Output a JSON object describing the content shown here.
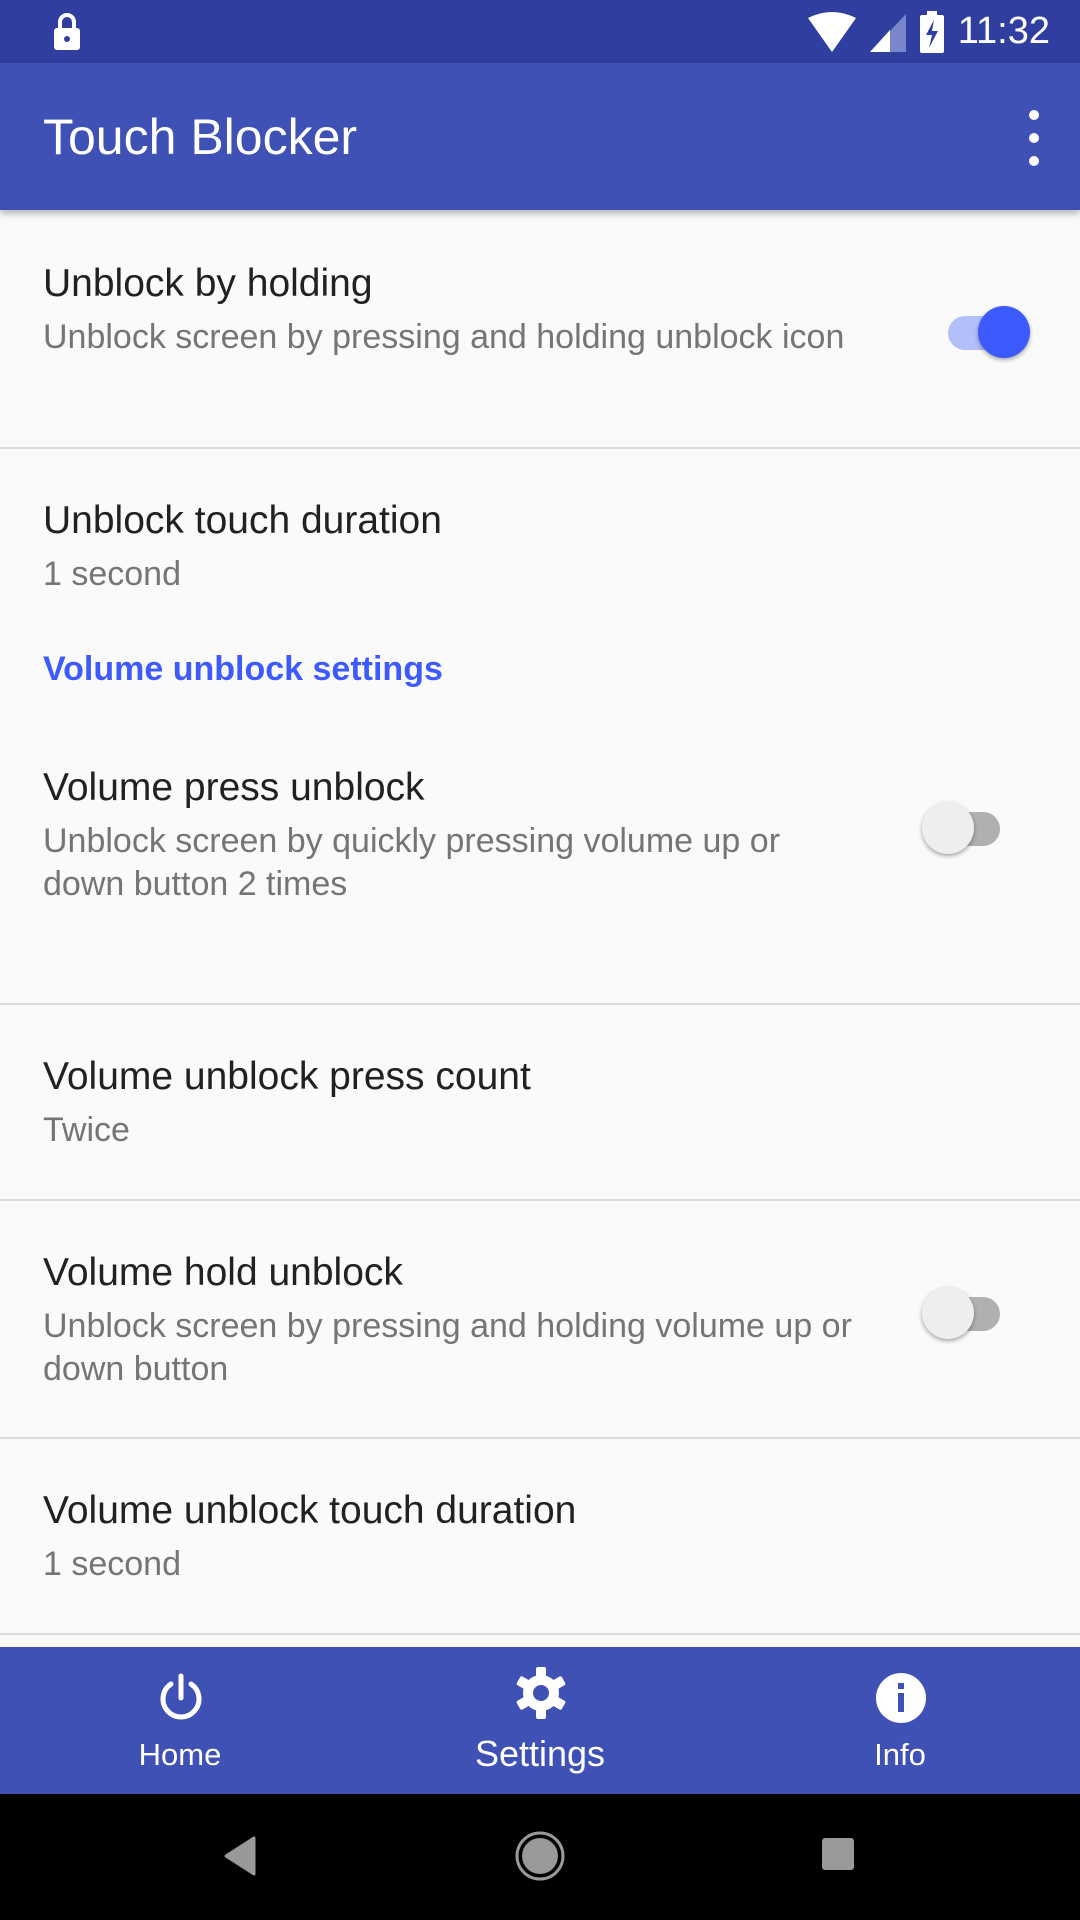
{
  "status_bar": {
    "time": "11:32"
  },
  "app_bar": {
    "title": "Touch Blocker"
  },
  "settings": [
    {
      "title": "Unblock by holding",
      "summary": "Unblock screen by pressing and holding unblock icon",
      "toggle": true
    },
    {
      "title": "Unblock touch duration",
      "summary": "1 second"
    },
    {
      "category": "Volume unblock settings"
    },
    {
      "title": "Volume press unblock",
      "summary": "Unblock screen by quickly pressing volume up or down button 2 times",
      "toggle": false
    },
    {
      "title": "Volume unblock press count",
      "summary": "Twice"
    },
    {
      "title": "Volume hold unblock",
      "summary": "Unblock screen by pressing and holding volume up or down button",
      "toggle": false
    },
    {
      "title": "Volume unblock touch duration",
      "summary": "1 second"
    }
  ],
  "bottom_nav": [
    {
      "label": "Home",
      "icon": "power-icon"
    },
    {
      "label": "Settings",
      "icon": "gear-icon",
      "active": true
    },
    {
      "label": "Info",
      "icon": "info-icon"
    }
  ],
  "colors": {
    "primary": "#3f51b5",
    "primary_dark": "#303f9f",
    "accent": "#3d5afe"
  }
}
